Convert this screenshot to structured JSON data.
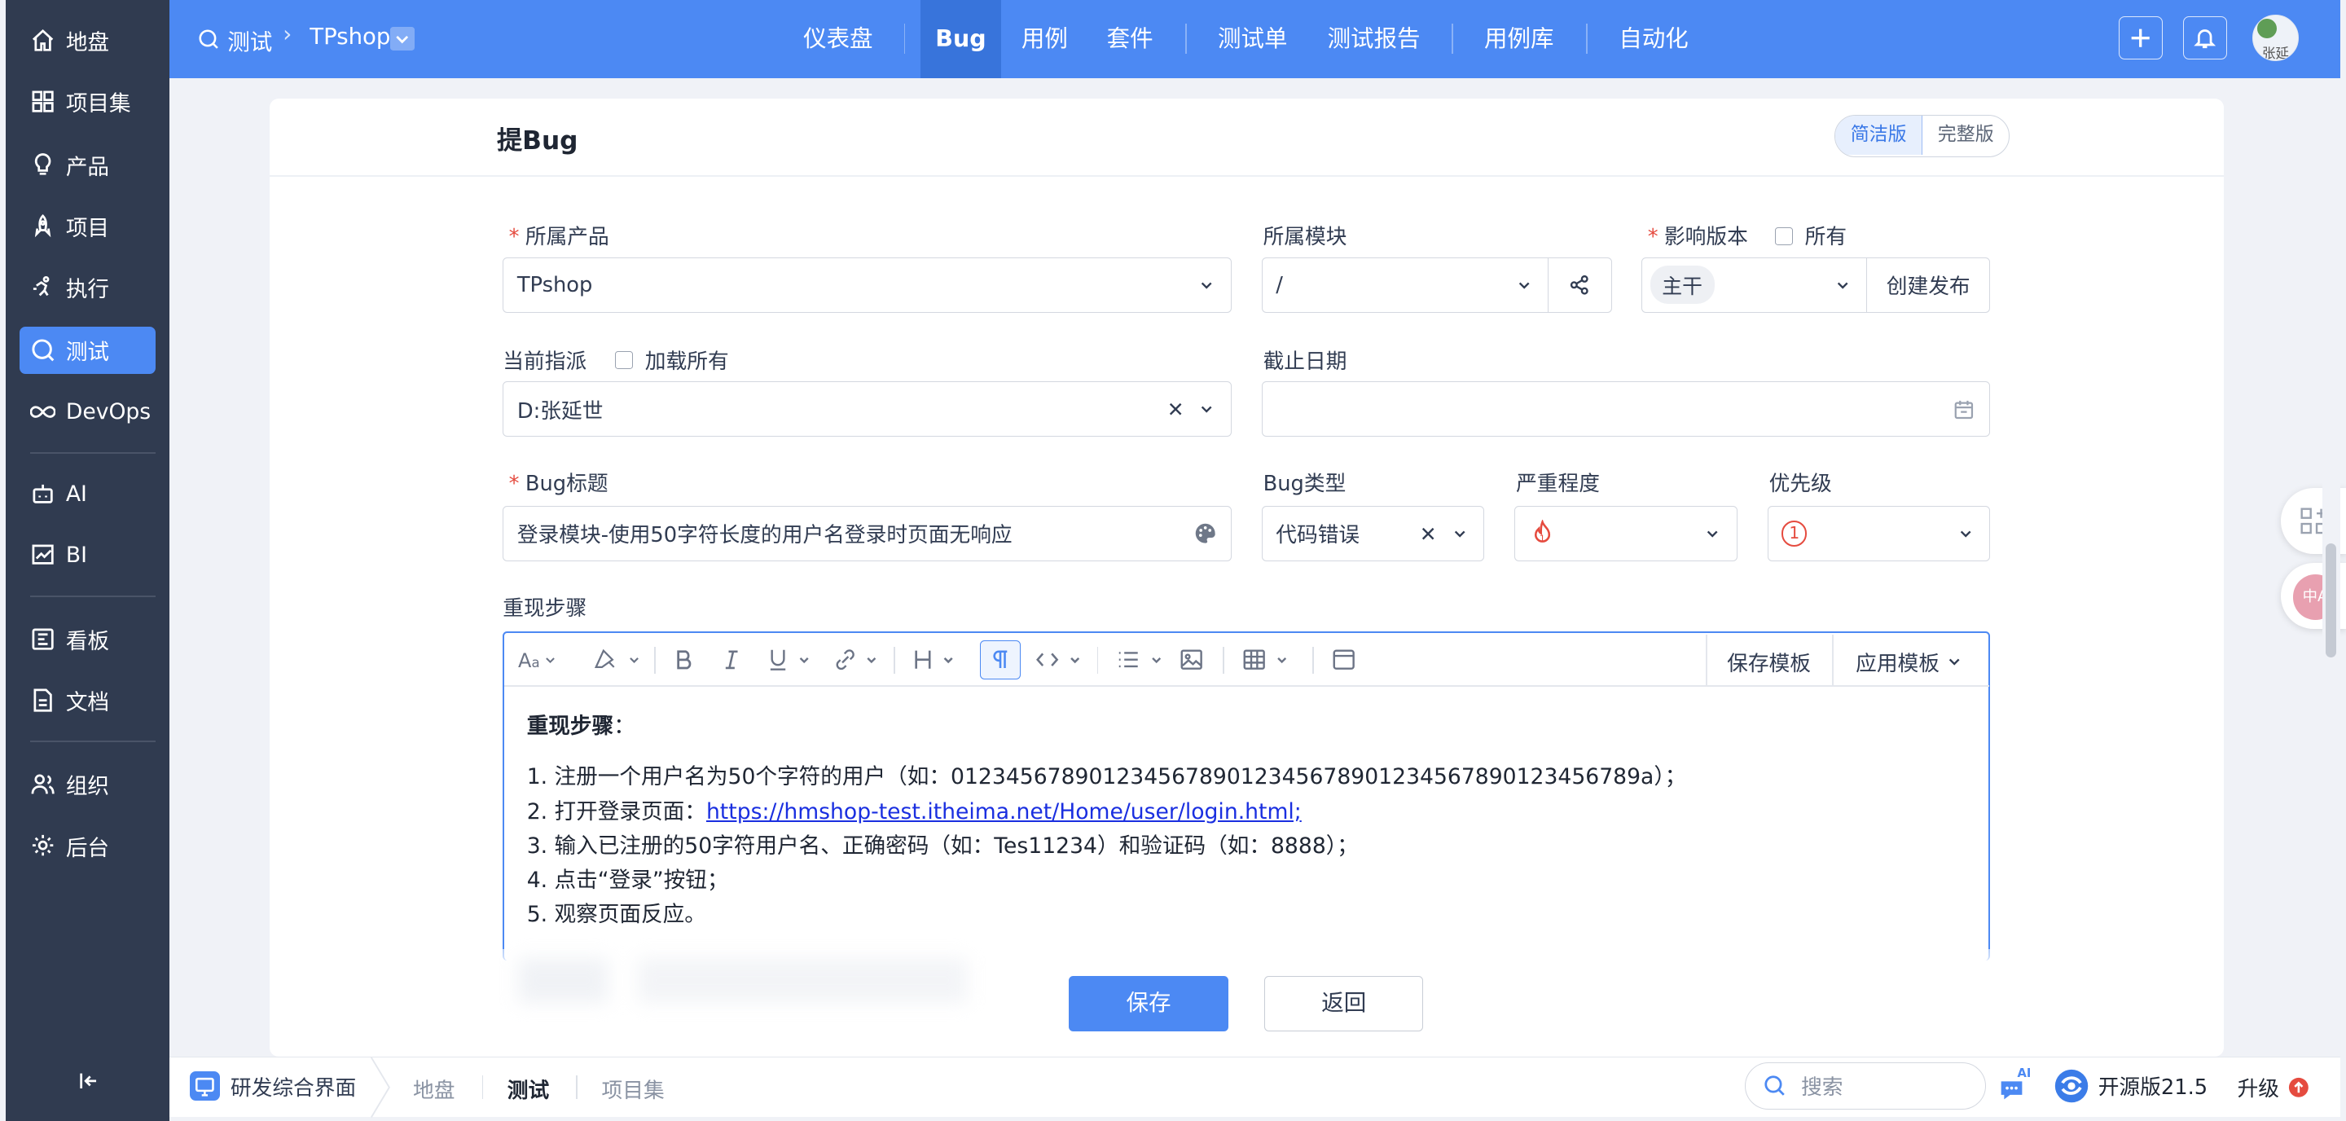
{
  "sidebar": {
    "items": [
      "地盘",
      "项目集",
      "产品",
      "项目",
      "执行",
      "测试",
      "DevOps",
      "AI",
      "BI",
      "看板",
      "文档",
      "组织",
      "后台"
    ],
    "active": "测试"
  },
  "header": {
    "crumb_module": "测试",
    "crumb_product": "TPshop",
    "nav": [
      "仪表盘",
      "Bug",
      "用例",
      "套件",
      "测试单",
      "测试报告",
      "用例库",
      "自动化"
    ],
    "active_nav": "Bug",
    "avatar_text": "张延"
  },
  "form": {
    "title": "提Bug",
    "mode_simple": "简洁版",
    "mode_full": "完整版",
    "product_label": "所属产品",
    "product_value": "TPshop",
    "module_label": "所属模块",
    "module_value": "/",
    "build_label": "影响版本",
    "build_all_label": "所有",
    "build_tag": "主干",
    "create_build_button": "创建发布",
    "assign_label": "当前指派",
    "assign_load_all": "加载所有",
    "assign_value": "D:张延世",
    "deadline_label": "截止日期",
    "deadline_value": "",
    "title_label": "Bug标题",
    "title_value": "登录模块-使用50字符长度的用户名登录时页面无响应",
    "type_label": "Bug类型",
    "type_value": "代码错误",
    "severity_label": "严重程度",
    "priority_label": "优先级",
    "priority_value": "1",
    "steps_label": "重现步骤",
    "save_template": "保存模板",
    "apply_template": "应用模板",
    "steps_heading": "重现步骤",
    "steps_colon": "：",
    "step_lines": [
      "1. 注册一个用户名为50个字符的用户（如：01234567890123456789012345678901234567890123456789a）；",
      "2. 打开登录页面：",
      "3. 输入已注册的50字符用户名、正确密码（如：Tes11234）和验证码（如：8888）；",
      "4. 点击“登录”按钮；",
      "5. 观察页面反应。"
    ],
    "step_link": "https://hmshop-test.itheima.net/Home/user/login.html;",
    "save_button": "保存",
    "back_button": "返回"
  },
  "footer": {
    "app_name": "研发综合界面",
    "crumbs": [
      "地盘",
      "测试",
      "项目集"
    ],
    "active_crumb": "测试",
    "search_placeholder": "搜索",
    "ai_badge": "AI",
    "version": "开源版21.5",
    "upgrade": "升级"
  },
  "colors": {
    "primary": "#4c89f3",
    "sidebar": "#303b50",
    "required": "#e54b3f"
  }
}
